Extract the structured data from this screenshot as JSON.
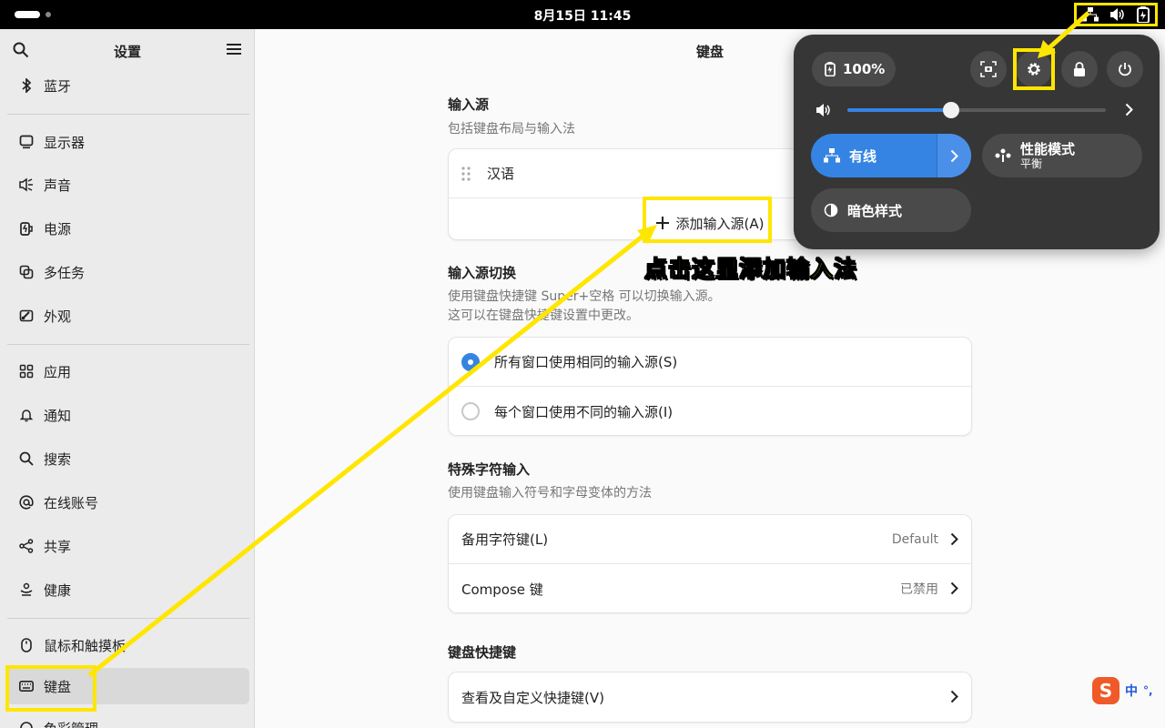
{
  "topbar": {
    "clock": "8月15日  11:45",
    "tray_icons": [
      "network-wired-icon",
      "volume-icon",
      "battery-icon"
    ]
  },
  "sidebar": {
    "title": "设置",
    "items": [
      {
        "label": "蓝牙",
        "icon": "bluetooth-icon"
      },
      {
        "label": "显示器",
        "icon": "display-icon"
      },
      {
        "label": "声音",
        "icon": "sound-icon"
      },
      {
        "label": "电源",
        "icon": "power-icon"
      },
      {
        "label": "多任务",
        "icon": "multitasking-icon"
      },
      {
        "label": "外观",
        "icon": "appearance-icon"
      },
      {
        "label": "应用",
        "icon": "apps-icon"
      },
      {
        "label": "通知",
        "icon": "bell-icon"
      },
      {
        "label": "搜索",
        "icon": "search-icon"
      },
      {
        "label": "在线账号",
        "icon": "at-icon"
      },
      {
        "label": "共享",
        "icon": "share-icon"
      },
      {
        "label": "健康",
        "icon": "wellbeing-icon"
      },
      {
        "label": "鼠标和触摸板",
        "icon": "mouse-icon"
      },
      {
        "label": "键盘",
        "icon": "keyboard-icon",
        "active": true
      },
      {
        "label": "色彩管理",
        "icon": "color-icon"
      }
    ]
  },
  "main": {
    "title": "键盘",
    "input_sources": {
      "title": "输入源",
      "desc": "包括键盘布局与输入法",
      "items": [
        "汉语"
      ],
      "add_label": "添加输入源(A)"
    },
    "switching": {
      "title": "输入源切换",
      "desc_line1": "使用键盘快捷键 Super+空格 可以切换输入源。",
      "desc_line2": "这可以在键盘快捷键设置中更改。",
      "options": [
        {
          "label": "所有窗口使用相同的输入源(S)",
          "selected": true
        },
        {
          "label": "每个窗口使用不同的输入源(I)",
          "selected": false
        }
      ]
    },
    "special": {
      "title": "特殊字符输入",
      "desc": "使用键盘输入符号和字母变体的方法",
      "rows": [
        {
          "label": "备用字符键(L)",
          "value": "Default"
        },
        {
          "label": "Compose 键",
          "value": "已禁用"
        }
      ]
    },
    "shortcuts": {
      "title": "键盘快捷键",
      "row_label": "查看及自定义快捷键(V)"
    }
  },
  "quick_settings": {
    "battery_label": "100%",
    "volume_level": 0.4,
    "wired_label": "有线",
    "power_mode_title": "性能模式",
    "power_mode_sub": "平衡",
    "dark_style_label": "暗色样式"
  },
  "annotation": {
    "text": "点击这里添加输入法",
    "color": "#ffe600"
  },
  "ime": {
    "logo": "S",
    "mode": "中",
    "punct": "°,"
  }
}
